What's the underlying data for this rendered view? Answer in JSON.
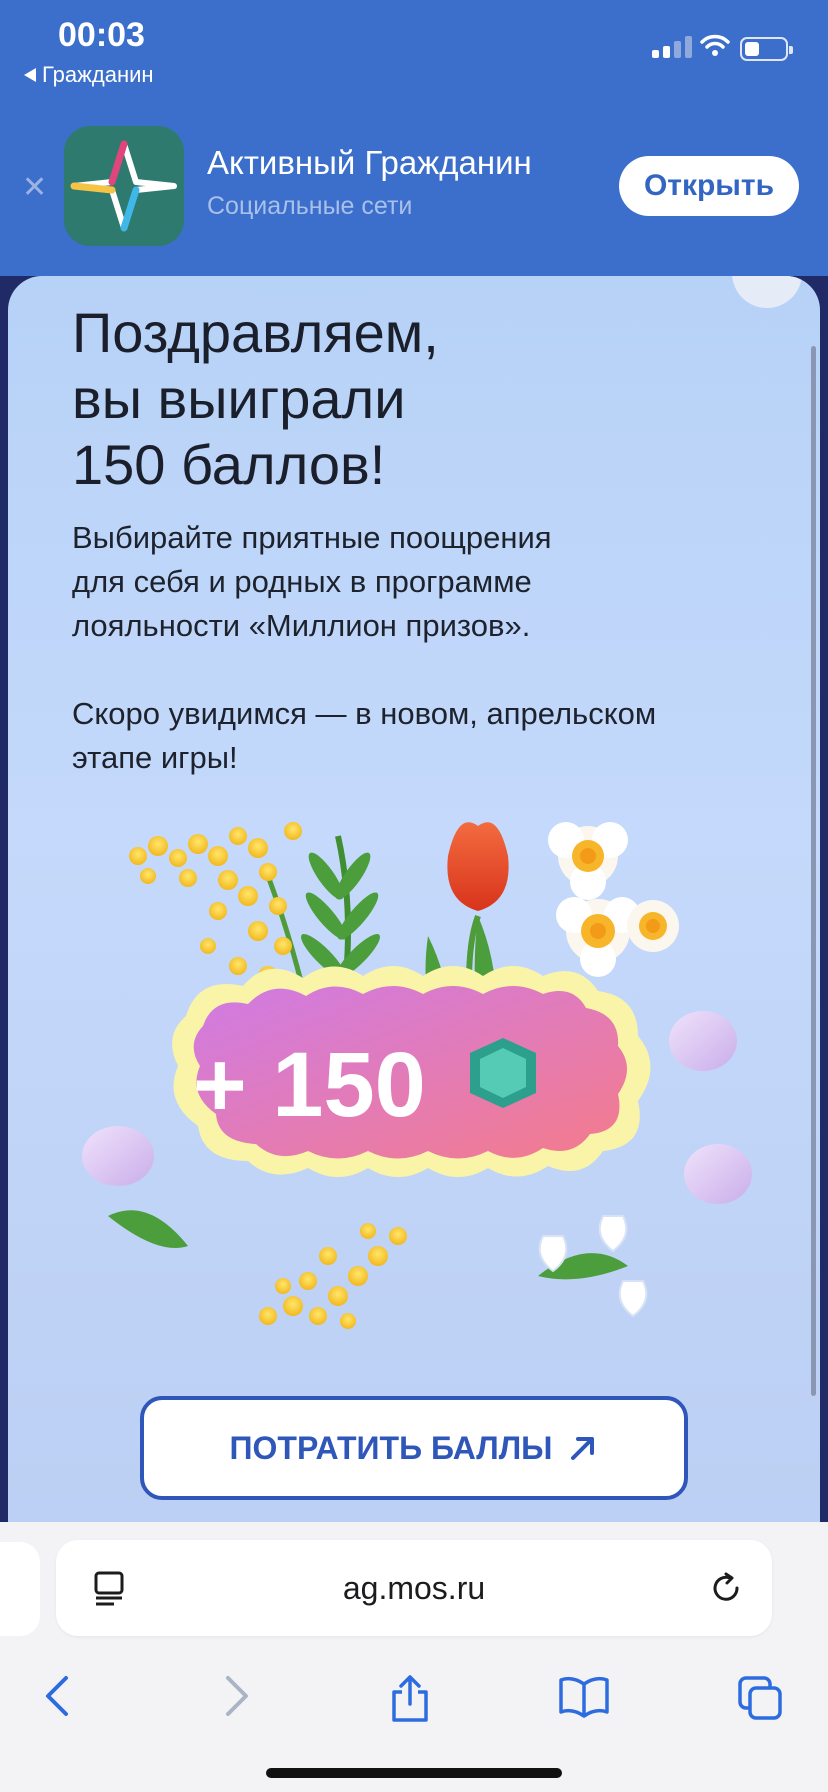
{
  "status_bar": {
    "time": "00:03",
    "back_app": "Гражданин"
  },
  "app_banner": {
    "app_name": "Активный Гражданин",
    "subtitle": "Социальные сети",
    "open_label": "Открыть"
  },
  "modal": {
    "title_lines": [
      "Поздравляем,",
      "вы выиграли",
      "150 баллов!"
    ],
    "desc_lines": [
      "Выбирайте приятные поощрения",
      "для себя и родных в программе",
      "лояльности «Миллион призов»."
    ],
    "desc2_lines": [
      "Скоро увидимся — в новом, апрельском",
      "этапе игры!"
    ],
    "points_badge": "+ 150",
    "cta_label": "ПОТРАТИТЬ БАЛЛЫ"
  },
  "browser": {
    "url": "ag.mos.ru"
  },
  "colors": {
    "accent": "#2f56b9",
    "banner": "#3b6fcb"
  }
}
